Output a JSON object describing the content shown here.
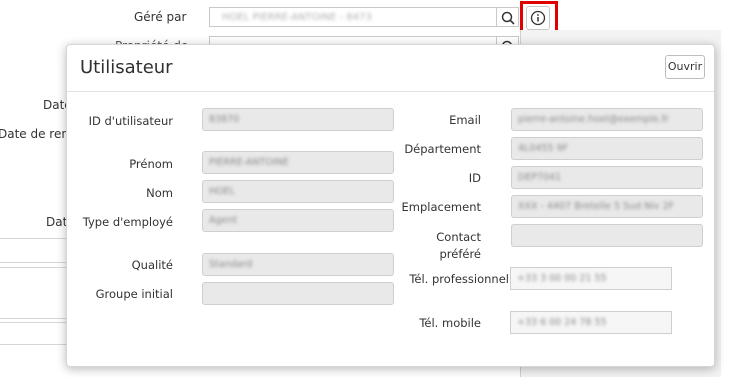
{
  "background_form": {
    "managed_by_label": "Géré par",
    "managed_by_value": "HOEL PIERRE-ANTOINE - 8473",
    "second_label_partial": "Propriété de",
    "second_value": "",
    "date_label_1": "Date",
    "renewal_label_partial": "Date de renou",
    "date_label_2": "Date"
  },
  "popup": {
    "title": "Utilisateur",
    "open_button": "Ouvrir",
    "left_fields": [
      {
        "label": "ID d'utilisateur",
        "value": "83870"
      },
      {
        "label": "Prénom",
        "value": "PIERRE-ANTOINE"
      },
      {
        "label": "Nom",
        "value": "HOEL"
      },
      {
        "label": "Type d'employé",
        "value": "Agent"
      },
      {
        "label": "Qualité",
        "value": "Standard"
      },
      {
        "label": "Groupe initial",
        "value": ""
      }
    ],
    "right_fields": [
      {
        "label": "Email",
        "value": "pierre-antoine.hoel@exemple.fr"
      },
      {
        "label": "Département",
        "value": "4L0455 9F"
      },
      {
        "label": "ID",
        "value": "DEP7041"
      },
      {
        "label": "Emplacement",
        "value": "XXX - 4407 Bretelle 5 Sud Niv 2F"
      },
      {
        "label": "Contact préféré",
        "value": ""
      },
      {
        "label": "Tél. professionnel",
        "value": "+33 3 00 00 21 55"
      },
      {
        "label": "Tél. mobile",
        "value": "+33 6 00 24 78 55"
      }
    ]
  },
  "icons": {
    "search": "search-icon",
    "info": "info-icon"
  },
  "colors": {
    "highlight": "#e00000"
  }
}
